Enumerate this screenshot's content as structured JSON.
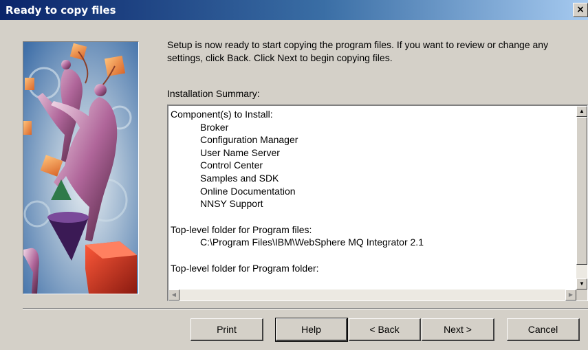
{
  "window": {
    "title": "Ready to copy files",
    "close_label": "×"
  },
  "intro_text": "Setup is now ready to start copying the program files.  If you want to review or change any settings, click Back. Click Next to begin copying files.",
  "summary": {
    "label": "Installation Summary:",
    "components_heading": "Component(s) to Install:",
    "components": [
      "Broker",
      "Configuration Manager",
      "User Name Server",
      "Control Center",
      "Samples and SDK",
      "Online Documentation",
      "NNSY Support"
    ],
    "program_files_heading": "Top-level folder for Program files:",
    "program_files_path": "C:\\Program Files\\IBM\\WebSphere MQ Integrator 2.1",
    "program_folder_heading": "Top-level folder for Program folder:"
  },
  "scrollbar": {
    "up": "▲",
    "down": "▼",
    "left": "◀",
    "right": "▶"
  },
  "buttons": {
    "print": "Print",
    "help": "Help",
    "back": "< Back",
    "next": "Next >",
    "cancel": "Cancel"
  }
}
